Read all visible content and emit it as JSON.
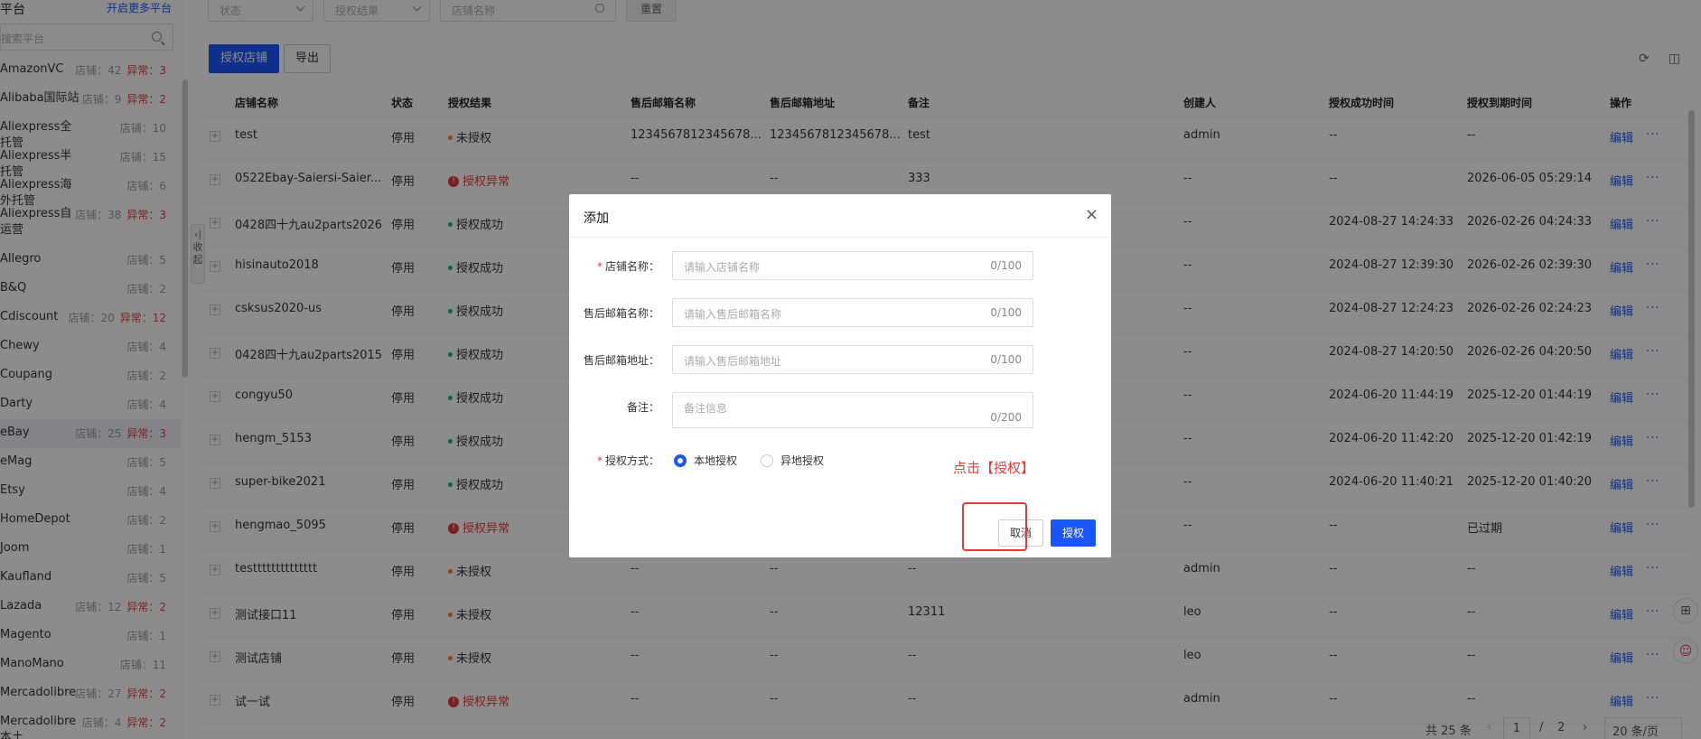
{
  "sidebar": {
    "title": "平台",
    "more_link": "开启更多平台",
    "search_placeholder": "搜索平台",
    "items": [
      {
        "name": "AmazonVC",
        "count": "店铺：42",
        "error": "异常：3"
      },
      {
        "name": "Alibaba国际站",
        "count": "店铺：9",
        "error": "异常：2"
      },
      {
        "name": "Aliexpress全托管",
        "count": "店铺：10",
        "error": ""
      },
      {
        "name": "Aliexpress半托管",
        "count": "店铺：15",
        "error": ""
      },
      {
        "name": "Aliexpress海外托管",
        "count": "店铺：6",
        "error": ""
      },
      {
        "name": "Aliexpress自运营",
        "count": "店铺：38",
        "error": "异常：3"
      },
      {
        "name": "Allegro",
        "count": "店铺：5",
        "error": ""
      },
      {
        "name": "B&Q",
        "count": "店铺：2",
        "error": ""
      },
      {
        "name": "Cdiscount",
        "count": "店铺：20",
        "error": "异常：12"
      },
      {
        "name": "Chewy",
        "count": "店铺：4",
        "error": ""
      },
      {
        "name": "Coupang",
        "count": "店铺：2",
        "error": ""
      },
      {
        "name": "Darty",
        "count": "店铺：4",
        "error": ""
      },
      {
        "name": "eBay",
        "count": "店铺：25",
        "error": "异常：3"
      },
      {
        "name": "eMag",
        "count": "店铺：5",
        "error": ""
      },
      {
        "name": "Etsy",
        "count": "店铺：4",
        "error": ""
      },
      {
        "name": "HomeDepot",
        "count": "店铺：2",
        "error": ""
      },
      {
        "name": "Joom",
        "count": "店铺：1",
        "error": ""
      },
      {
        "name": "Kaufland",
        "count": "店铺：5",
        "error": ""
      },
      {
        "name": "Lazada",
        "count": "店铺：12",
        "error": "异常：2"
      },
      {
        "name": "Magento",
        "count": "店铺：1",
        "error": ""
      },
      {
        "name": "ManoMano",
        "count": "店铺：11",
        "error": ""
      },
      {
        "name": "Mercadolibre",
        "count": "店铺：27",
        "error": "异常：2"
      },
      {
        "name": "Mercadolibre本土",
        "count": "店铺：4",
        "error": "异常：2"
      }
    ],
    "collapse_label": "收起"
  },
  "filters": {
    "status_placeholder": "状态",
    "result_placeholder": "授权结果",
    "name_placeholder": "店铺名称",
    "reset_label": "重置"
  },
  "toolbar": {
    "authorize_label": "授权店铺",
    "export_label": "导出",
    "refresh_icon": "refresh-icon",
    "columns_icon": "columns-icon"
  },
  "table": {
    "headers": [
      "店铺名称",
      "状态",
      "授权结果",
      "售后邮箱名称",
      "售后邮箱地址",
      "备注",
      "创建人",
      "授权成功时间",
      "授权到期时间",
      "操作"
    ],
    "rows": [
      {
        "name": "test",
        "status": "停用",
        "result": "未授权",
        "result_type": "none",
        "mail_name": "1234567812345678...",
        "mail_addr": "1234567812345678...",
        "note": "test",
        "creator": "admin",
        "success_time": "--",
        "expire_time": "--"
      },
      {
        "name": "0522Ebay-Saiersi-Saier...",
        "status": "停用",
        "result": "授权异常",
        "result_type": "error",
        "mail_name": "--",
        "mail_addr": "--",
        "note": "333",
        "creator": "--",
        "success_time": "--",
        "expire_time": "2026-06-05 05:29:14"
      },
      {
        "name": "0428四十九au2parts2026",
        "status": "停用",
        "result": "授权成功",
        "result_type": "ok",
        "mail_name": "",
        "mail_addr": "",
        "note": "",
        "creator": "--",
        "success_time": "2024-08-27 14:24:33",
        "expire_time": "2026-02-26 04:24:33"
      },
      {
        "name": "hisinauto2018",
        "status": "停用",
        "result": "授权成功",
        "result_type": "ok",
        "mail_name": "",
        "mail_addr": "",
        "note": "",
        "creator": "--",
        "success_time": "2024-08-27 12:39:30",
        "expire_time": "2026-02-26 02:39:30"
      },
      {
        "name": "csksus2020-us",
        "status": "停用",
        "result": "授权成功",
        "result_type": "ok",
        "mail_name": "",
        "mail_addr": "",
        "note": "",
        "creator": "--",
        "success_time": "2024-08-27 12:24:23",
        "expire_time": "2026-02-26 02:24:23"
      },
      {
        "name": "0428四十九au2parts2015",
        "status": "停用",
        "result": "授权成功",
        "result_type": "ok",
        "mail_name": "",
        "mail_addr": "",
        "note": "",
        "creator": "--",
        "success_time": "2024-08-27 14:20:50",
        "expire_time": "2026-02-26 04:20:50"
      },
      {
        "name": "congyu50",
        "status": "停用",
        "result": "授权成功",
        "result_type": "ok",
        "mail_name": "",
        "mail_addr": "",
        "note": "",
        "creator": "--",
        "success_time": "2024-06-20 11:44:19",
        "expire_time": "2025-12-20 01:44:19"
      },
      {
        "name": "hengm_5153",
        "status": "停用",
        "result": "授权成功",
        "result_type": "ok",
        "mail_name": "",
        "mail_addr": "",
        "note": "",
        "creator": "--",
        "success_time": "2024-06-20 11:42:20",
        "expire_time": "2025-12-20 01:42:19"
      },
      {
        "name": "super-bike2021",
        "status": "停用",
        "result": "授权成功",
        "result_type": "ok",
        "mail_name": "",
        "mail_addr": "",
        "note": "",
        "creator": "--",
        "success_time": "2024-06-20 11:40:21",
        "expire_time": "2025-12-20 01:40:20"
      },
      {
        "name": "hengmao_5095",
        "status": "停用",
        "result": "授权异常",
        "result_type": "error",
        "mail_name": "",
        "mail_addr": "",
        "note": "",
        "creator": "--",
        "success_time": "--",
        "expire_time": "已过期"
      },
      {
        "name": "testttttttttttttt",
        "status": "停用",
        "result": "未授权",
        "result_type": "none",
        "mail_name": "--",
        "mail_addr": "--",
        "note": "--",
        "creator": "admin",
        "success_time": "--",
        "expire_time": "--"
      },
      {
        "name": "测试接口11",
        "status": "停用",
        "result": "未授权",
        "result_type": "none",
        "mail_name": "--",
        "mail_addr": "--",
        "note": "12311",
        "creator": "leo",
        "success_time": "--",
        "expire_time": "--"
      },
      {
        "name": "测试店铺",
        "status": "停用",
        "result": "未授权",
        "result_type": "none",
        "mail_name": "--",
        "mail_addr": "--",
        "note": "--",
        "creator": "leo",
        "success_time": "--",
        "expire_time": "--"
      },
      {
        "name": "试一试",
        "status": "停用",
        "result": "授权异常",
        "result_type": "error",
        "mail_name": "--",
        "mail_addr": "--",
        "note": "--",
        "creator": "admin",
        "success_time": "--",
        "expire_time": "--"
      }
    ],
    "edit_label": "编辑",
    "more_label": "···"
  },
  "pagination": {
    "total": "共 25 条",
    "current": "1",
    "separator": "/",
    "pages": "2",
    "page_size": "20 条/页"
  },
  "modal": {
    "title": "添加",
    "fields": [
      {
        "label": "店铺名称：",
        "required": true,
        "placeholder": "请输入店铺名称",
        "counter": "0/100"
      },
      {
        "label": "售后邮箱名称：",
        "required": false,
        "placeholder": "请输入售后邮箱名称",
        "counter": "0/100"
      },
      {
        "label": "售后邮箱地址：",
        "required": false,
        "placeholder": "请输入售后邮箱地址",
        "counter": "0/100"
      },
      {
        "label": "备注：",
        "required": false,
        "placeholder": "备注信息",
        "counter": "0/200"
      }
    ],
    "auth_label": "授权方式：",
    "auth_options": [
      "本地授权",
      "异地授权"
    ],
    "auth_selected": "本地授权",
    "hint": "点击【授权】",
    "cancel_label": "取消",
    "confirm_label": "授权"
  },
  "colors": {
    "primary": "#1a56ff",
    "error": "#e23b3b",
    "success": "#1dba66",
    "warning": "#f5822a"
  }
}
